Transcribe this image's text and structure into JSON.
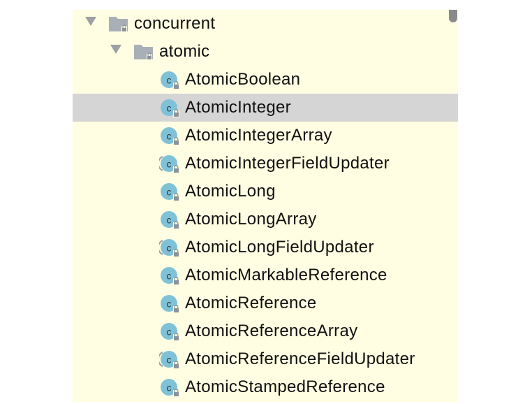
{
  "tree": {
    "root": {
      "label": "concurrent",
      "icon": "folder-icon",
      "expanded": true
    },
    "package": {
      "label": "atomic",
      "icon": "package-folder-icon",
      "expanded": true
    },
    "classes": [
      {
        "label": "AtomicBoolean",
        "icon": "class-icon"
      },
      {
        "label": "AtomicInteger",
        "icon": "class-icon",
        "selected": true
      },
      {
        "label": "AtomicIntegerArray",
        "icon": "class-icon"
      },
      {
        "label": "AtomicIntegerFieldUpdater",
        "icon": "abstract-class-icon"
      },
      {
        "label": "AtomicLong",
        "icon": "class-icon"
      },
      {
        "label": "AtomicLongArray",
        "icon": "class-icon"
      },
      {
        "label": "AtomicLongFieldUpdater",
        "icon": "abstract-class-icon"
      },
      {
        "label": "AtomicMarkableReference",
        "icon": "class-icon"
      },
      {
        "label": "AtomicReference",
        "icon": "class-icon"
      },
      {
        "label": "AtomicReferenceArray",
        "icon": "class-icon"
      },
      {
        "label": "AtomicReferenceFieldUpdater",
        "icon": "abstract-class-icon"
      },
      {
        "label": "AtomicStampedReference",
        "icon": "class-icon"
      }
    ]
  },
  "colors": {
    "panel_background": "#fffee2",
    "selection": "#d5d5d5",
    "class_icon": "#7fc2d8",
    "folder": "#a8afb7"
  }
}
